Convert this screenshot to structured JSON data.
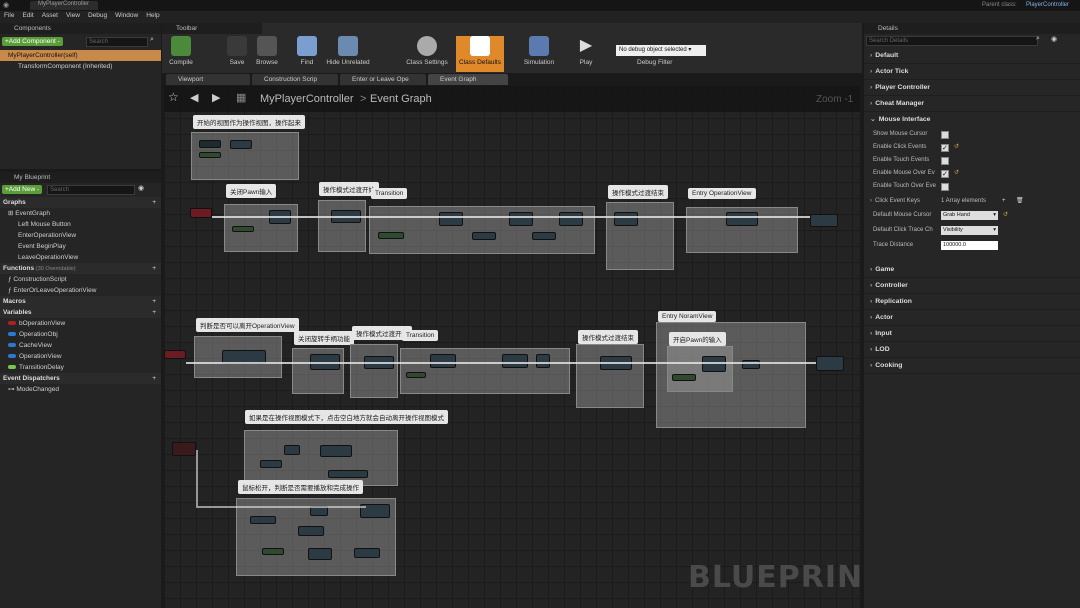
{
  "window": {
    "title": "MyPlayerController",
    "parent_class_label": "Parent class:",
    "parent_class": "PlayerController"
  },
  "menu": [
    "File",
    "Edit",
    "Asset",
    "View",
    "Debug",
    "Window",
    "Help"
  ],
  "components": {
    "header": "Components",
    "add_button": "+Add Component -",
    "search_placeholder": "Search",
    "items": [
      "MyPlayerController(self)",
      "TransformComponent (Inherited)"
    ]
  },
  "toolbar": {
    "header": "Toolbar",
    "buttons": [
      "Compile",
      "Save",
      "Browse",
      "Find",
      "Hide Unrelated",
      "Class Settings",
      "Class Defaults",
      "Simulation",
      "Play"
    ],
    "debug_select": "No debug object selected",
    "debug_filter": "Debug Filter"
  },
  "tabs": [
    "Viewport",
    "Construction Scrip",
    "Enter or Leave Ope",
    "Event Graph"
  ],
  "breadcrumb": {
    "root": "MyPlayerController",
    "sep": ">",
    "current": "Event Graph",
    "zoom": "Zoom -1"
  },
  "watermark": "BLUEPRINT",
  "myblueprint": {
    "header": "My Blueprint",
    "add_button": "+Add New -",
    "search_placeholder": "Search",
    "graphs_label": "Graphs",
    "graphs": [
      "EventGraph",
      "Left Mouse Button",
      "EnterOperationView",
      "Event BeginPlay",
      "LeaveOperationView"
    ],
    "functions_label": "Functions",
    "functions_note": "(30 Overridable)",
    "functions": [
      "ConstructionScript",
      "EnterOrLeaveOperationView"
    ],
    "macros_label": "Macros",
    "variables_label": "Variables",
    "variables": [
      "bOperationView",
      "OperationObj",
      "CacheView",
      "OperationView",
      "TransitionDelay"
    ],
    "dispatchers_label": "Event Dispatchers",
    "dispatchers": [
      "ModeChanged"
    ]
  },
  "comments": [
    "开始的视图作为操作视图，操作起来",
    "关闭Pawn输入",
    "操作模式过渡开始",
    "Transition",
    "操作模式过渡结束",
    "Entry OperationView",
    "判断是否可以离开OperationView",
    "关闭旋转手柄功能",
    "操作模式过渡开始",
    "Transition",
    "操作模式过渡结束",
    "Entry NoramView",
    "开启Pawn的输入",
    "如果是在操作视图模式下，点击空白地方就会自动离开操作视图模式",
    "鼠标松开，判断是否需要播放和完成操作"
  ],
  "details": {
    "header": "Details",
    "search_placeholder": "Search Details",
    "sections": [
      "Default",
      "Actor Tick",
      "Player Controller",
      "Cheat Manager"
    ],
    "mouse_section": "Mouse Interface",
    "props": [
      {
        "label": "Show Mouse Cursor",
        "checked": false
      },
      {
        "label": "Enable Click Events",
        "checked": true
      },
      {
        "label": "Enable Touch Events",
        "checked": false
      },
      {
        "label": "Enable Mouse Over Ev",
        "checked": true
      },
      {
        "label": "Enable Touch Over Eve",
        "checked": false
      }
    ],
    "click_keys_label": "Click Event Keys",
    "click_keys_value": "1 Array elements",
    "cursor_label": "Default Mouse Cursor",
    "cursor_value": "Grab Hand",
    "trace_label": "Default Click Trace Ch",
    "trace_value": "Visibility",
    "trace_dist_label": "Trace Distance",
    "trace_dist_value": "100000.0",
    "more_sections": [
      "Game",
      "Controller",
      "Replication",
      "Actor",
      "Input",
      "LOD",
      "Cooking"
    ]
  }
}
